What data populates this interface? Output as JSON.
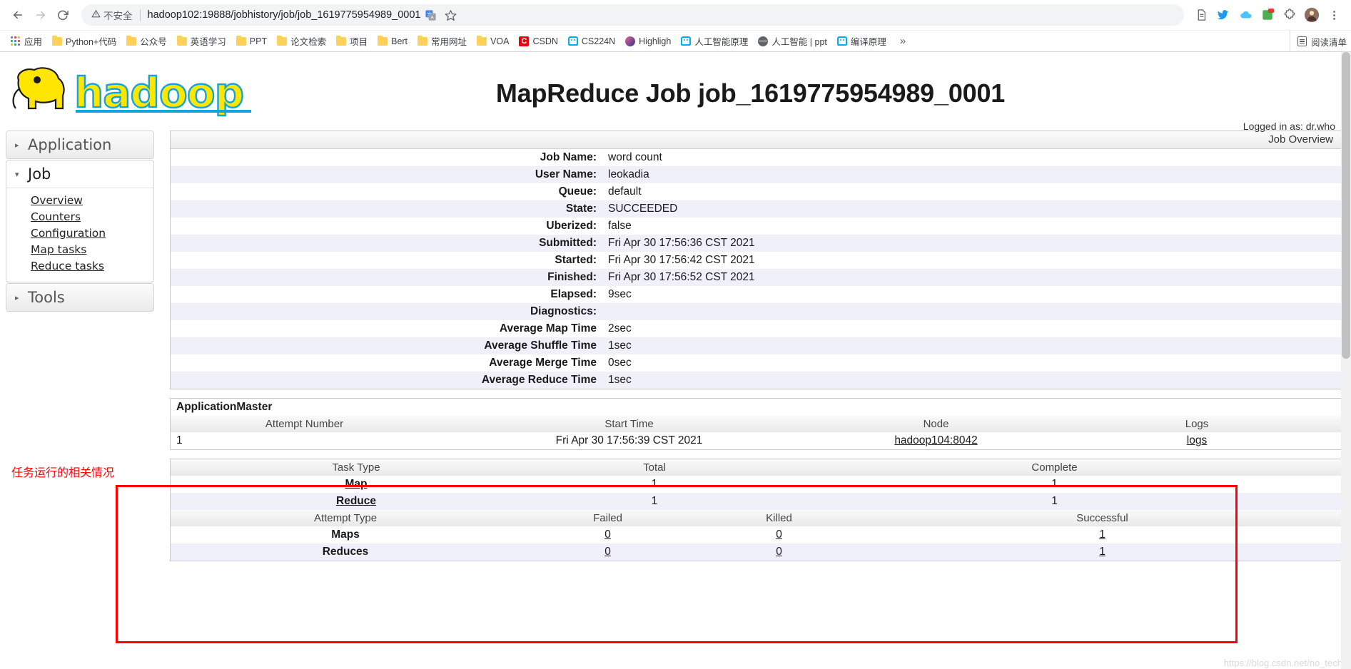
{
  "browser": {
    "nav": {
      "back_icon": "arrow-left-icon",
      "forward_icon": "arrow-right-icon",
      "reload_icon": "reload-icon"
    },
    "omnibox": {
      "security_label": "不安全",
      "security_icon": "warning-triangle-icon",
      "url": "hadoop102:19888/jobhistory/job/job_1619775954989_0001",
      "translate_icon": "translate-icon",
      "bookmark_icon": "star-icon"
    },
    "extensions": [
      "page-icon",
      "bird-icon",
      "cloud-icon",
      "badge-icon",
      "puzzle-icon",
      "profile-avatar-icon",
      "menu-icon"
    ],
    "bookmarks": [
      {
        "label": "应用",
        "icon": "apps-grid-icon"
      },
      {
        "label": "Python+代码",
        "icon": "folder-icon"
      },
      {
        "label": "公众号",
        "icon": "folder-icon"
      },
      {
        "label": "英语学习",
        "icon": "folder-icon"
      },
      {
        "label": "PPT",
        "icon": "folder-icon"
      },
      {
        "label": "论文检索",
        "icon": "folder-icon"
      },
      {
        "label": "项目",
        "icon": "folder-icon"
      },
      {
        "label": "Bert",
        "icon": "folder-icon"
      },
      {
        "label": "常用网址",
        "icon": "folder-icon"
      },
      {
        "label": "VOA",
        "icon": "folder-icon"
      },
      {
        "label": "CSDN",
        "icon": "csdn-icon"
      },
      {
        "label": "CS224N",
        "icon": "robot-icon"
      },
      {
        "label": "Highligh",
        "icon": "drop-icon"
      },
      {
        "label": "人工智能原理",
        "icon": "robot-icon"
      },
      {
        "label": "人工智能 | ppt",
        "icon": "globe-icon"
      },
      {
        "label": "编译原理",
        "icon": "robot-icon"
      }
    ],
    "bookmarks_overflow": "»",
    "reading_list": {
      "label": "阅读清单",
      "icon": "reading-list-icon"
    }
  },
  "page": {
    "logo_text": "hadoop",
    "title": "MapReduce Job job_1619775954989_0001",
    "logged_in": "Logged in as: dr.who",
    "annotation": "任务运行的相关情况",
    "watermark": "https://blog.csdn.net/no_tech"
  },
  "sidebar": {
    "sections": [
      {
        "label": "Application",
        "expanded": false,
        "triangle": "▸",
        "items": []
      },
      {
        "label": "Job",
        "expanded": true,
        "triangle": "▾",
        "items": [
          "Overview",
          "Counters",
          "Configuration",
          "Map tasks",
          "Reduce tasks"
        ]
      },
      {
        "label": "Tools",
        "expanded": false,
        "triangle": "▸",
        "items": []
      }
    ]
  },
  "job_overview": {
    "caption": "Job Overview",
    "rows": [
      {
        "key": "Job Name:",
        "value": "word count"
      },
      {
        "key": "User Name:",
        "value": "leokadia"
      },
      {
        "key": "Queue:",
        "value": "default"
      },
      {
        "key": "State:",
        "value": "SUCCEEDED"
      },
      {
        "key": "Uberized:",
        "value": "false"
      },
      {
        "key": "Submitted:",
        "value": "Fri Apr 30 17:56:36 CST 2021"
      },
      {
        "key": "Started:",
        "value": "Fri Apr 30 17:56:42 CST 2021"
      },
      {
        "key": "Finished:",
        "value": "Fri Apr 30 17:56:52 CST 2021"
      },
      {
        "key": "Elapsed:",
        "value": "9sec"
      },
      {
        "key": "Diagnostics:",
        "value": ""
      },
      {
        "key": "Average Map Time",
        "value": "2sec"
      },
      {
        "key": "Average Shuffle Time",
        "value": "1sec"
      },
      {
        "key": "Average Merge Time",
        "value": "0sec"
      },
      {
        "key": "Average Reduce Time",
        "value": "1sec"
      }
    ]
  },
  "application_master": {
    "title": "ApplicationMaster",
    "headers": [
      "Attempt Number",
      "Start Time",
      "Node",
      "Logs"
    ],
    "row": {
      "attempt": "1",
      "start_time": "Fri Apr 30 17:56:39 CST 2021",
      "node": "hadoop104:8042",
      "logs": "logs"
    }
  },
  "task_table": {
    "headers": [
      "Task Type",
      "Total",
      "Complete"
    ],
    "rows": [
      {
        "type": "Map",
        "total": "1",
        "complete": "1"
      },
      {
        "type": "Reduce",
        "total": "1",
        "complete": "1"
      }
    ]
  },
  "attempt_table": {
    "headers": [
      "Attempt Type",
      "Failed",
      "Killed",
      "Successful"
    ],
    "rows": [
      {
        "type": "Maps",
        "failed": "0",
        "killed": "0",
        "successful": "1"
      },
      {
        "type": "Reduces",
        "failed": "0",
        "killed": "0",
        "successful": "1"
      }
    ]
  }
}
